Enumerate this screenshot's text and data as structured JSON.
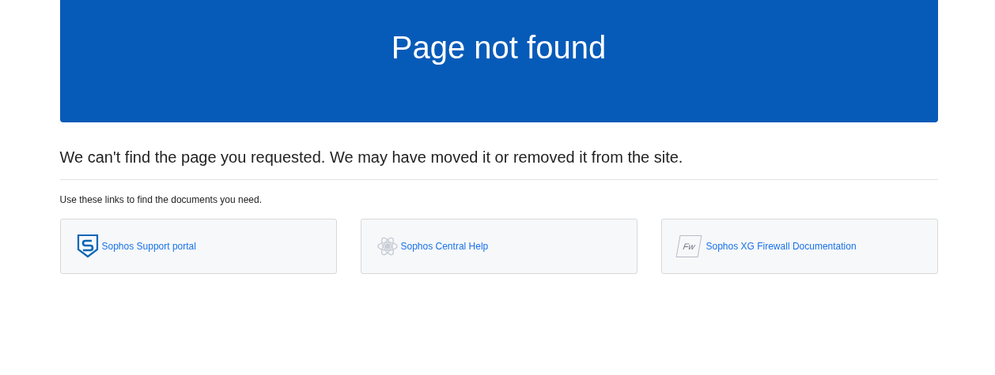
{
  "banner": {
    "title": "Page not found"
  },
  "message": "We can't find the page you requested. We may have moved it or removed it from the site.",
  "hint": "Use these links to find the documents you need.",
  "links": [
    {
      "kind": "shield",
      "label": "Sophos Support portal"
    },
    {
      "kind": "atom",
      "label": "Sophos Central Help"
    },
    {
      "kind": "badge",
      "badge": "Fw",
      "label": "Sophos XG Firewall Documentation"
    }
  ]
}
